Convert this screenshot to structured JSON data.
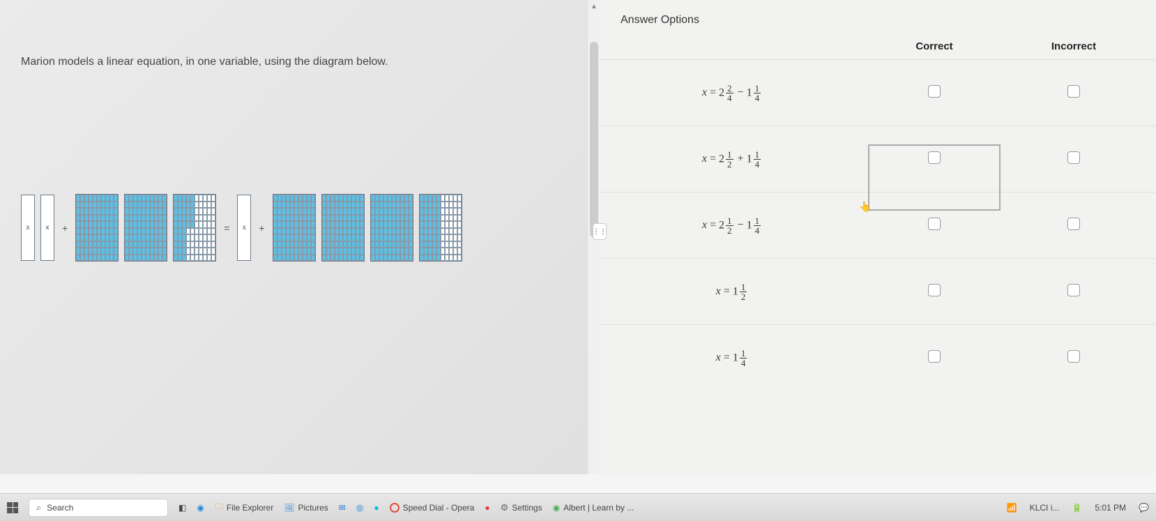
{
  "question": {
    "prompt": "Marion models a linear equation, in one variable, using the diagram below.",
    "diagram": {
      "left_tiles": [
        "x",
        "x"
      ],
      "left_op": "+",
      "equals": "=",
      "right_tiles": [
        "x"
      ],
      "right_op": "+"
    }
  },
  "answer_panel": {
    "title": "Answer Options",
    "headers": {
      "correct": "Correct",
      "incorrect": "Incorrect"
    },
    "options": [
      {
        "var": "x",
        "eq": "=",
        "w1": "2",
        "n1": "2",
        "d1": "4",
        "op": "−",
        "w2": "1",
        "n2": "1",
        "d2": "4"
      },
      {
        "var": "x",
        "eq": "=",
        "w1": "2",
        "n1": "1",
        "d1": "2",
        "op": "+",
        "w2": "1",
        "n2": "1",
        "d2": "4"
      },
      {
        "var": "x",
        "eq": "=",
        "w1": "2",
        "n1": "1",
        "d1": "2",
        "op": "−",
        "w2": "1",
        "n2": "1",
        "d2": "4"
      },
      {
        "var": "x",
        "eq": "=",
        "w1": "1",
        "n1": "1",
        "d1": "2",
        "op": "",
        "w2": "",
        "n2": "",
        "d2": ""
      },
      {
        "var": "x",
        "eq": "=",
        "w1": "1",
        "n1": "1",
        "d1": "4",
        "op": "",
        "w2": "",
        "n2": "",
        "d2": ""
      }
    ]
  },
  "taskbar": {
    "search_placeholder": "Search",
    "items": {
      "file_explorer": "File Explorer",
      "pictures": "Pictures",
      "speed_dial": "Speed Dial - Opera",
      "settings": "Settings",
      "albert": "Albert | Learn by ...",
      "klci": "KLCI i...",
      "time": "5:01 PM"
    }
  }
}
